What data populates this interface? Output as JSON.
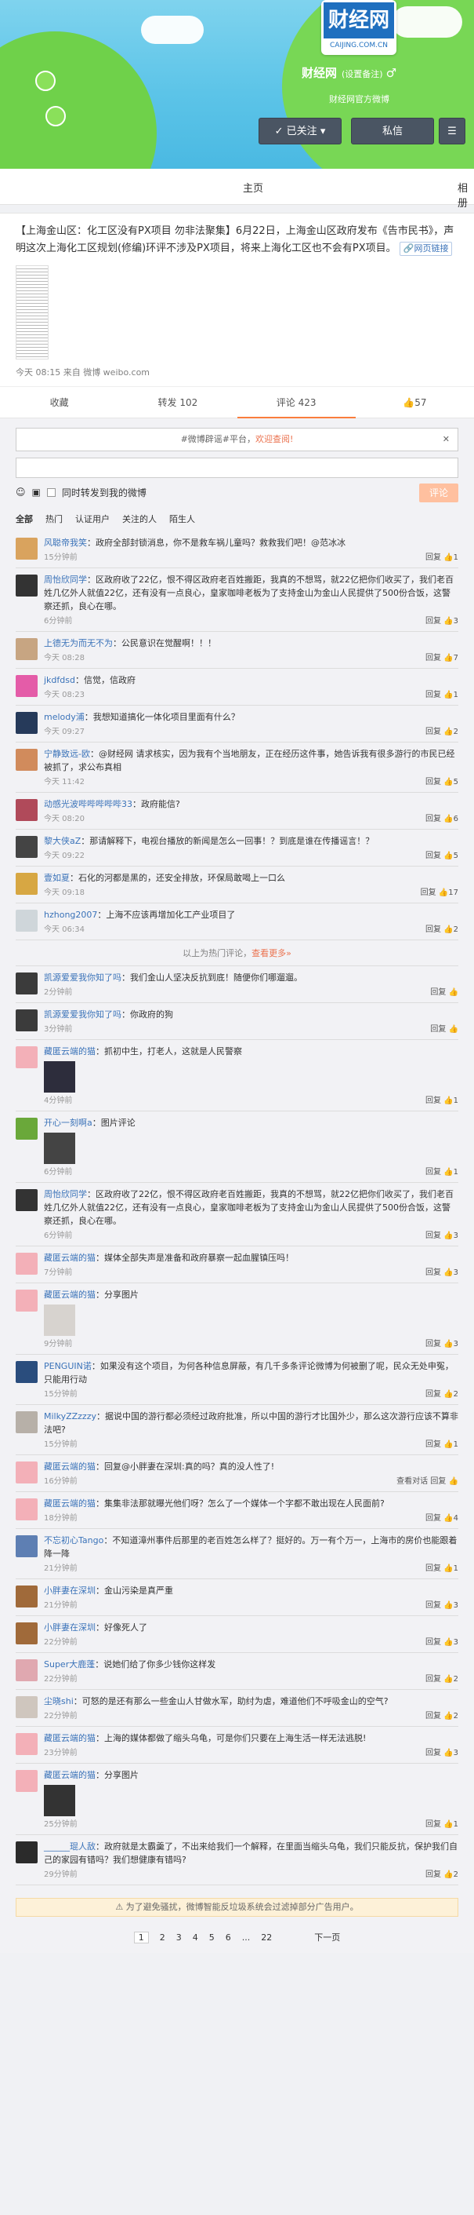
{
  "header": {
    "logo_text": "财经网",
    "logo_url": "CAIJING.COM.CN",
    "name": "财经网",
    "note": "(设置备注)",
    "gender": "♂",
    "desc": "财经网官方微博",
    "follow_btn": "✓ 已关注 ▾",
    "msg_btn": "私信",
    "menu": "☰",
    "colors": {
      "sky": "#5cc4e8",
      "grass": "#6fd14a"
    }
  },
  "tabs": {
    "home": "主页",
    "album": "相册"
  },
  "weibo": {
    "text": "【上海金山区：化工区没有PX项目 勿非法聚集】6月22日，上海金山区政府发布《告市民书》，声明这次上海化工区规划(修编)环评不涉及PX项目，将来上海化工区也不会有PX项目。",
    "link_label": "网页链接",
    "meta": "今天 08:15 来自 微博 weibo.com",
    "actions": {
      "fav": "收藏",
      "repost": "转发 102",
      "comment": "评论 423",
      "like": "57"
    }
  },
  "composer": {
    "topic": "#微博辟谣#平台，欢迎查阅!",
    "topic_pre": "#微博辟谣#平台，",
    "topic_link": "欢迎查阅!",
    "close": "✕",
    "sync_label": "同时转发到我的微博",
    "post_btn": "评论"
  },
  "filters": [
    "全部",
    "热门",
    "认证用户",
    "关注的人",
    "陌生人"
  ],
  "hot": [
    {
      "user": "风聪帝我笑",
      "text": "：政府全部封锁消息，你不是救车祸儿童吗？救救我们吧！@范冰冰",
      "time": "15分钟前",
      "reply": "回复",
      "like": "1",
      "c": "#d9a35e"
    },
    {
      "user": "周怡欣同学",
      "text": "：区政府收了22亿，恨不得区政府老百姓搬距，我真的不想骂，就22亿把你们收买了，我们老百姓几亿外人就值22亿，还有没有一点良心，皇家咖啡老板为了支持金山为金山人民提供了500份合饭，这警察还抓，良心在哪。",
      "time": "6分钟前",
      "reply": "回复",
      "like": "3",
      "c": "#333"
    },
    {
      "user": "上德无为而无不为",
      "text": "：公民意识在觉醒啊！！！",
      "time": "今天 08:28",
      "reply": "回复",
      "like": "7",
      "c": "#c7a582"
    },
    {
      "user": "jkdfdsd",
      "text": "：信觉，信政府",
      "time": "今天 08:23",
      "reply": "回复",
      "like": "1",
      "c": "#e45ca8"
    },
    {
      "user": "melody浦",
      "text": "：我想知道搞化一体化项目里面有什么？",
      "time": "今天 09:27",
      "reply": "回复",
      "like": "2",
      "c": "#263a5a"
    },
    {
      "user": "宁静致远-欧",
      "text": "：@财经网 请求核实，因为我有个当地朋友，正在经历这件事，她告诉我有很多游行的市民已经被抓了，求公布真相",
      "time": "今天 11:42",
      "reply": "回复",
      "like": "5",
      "c": "#d18b5c"
    },
    {
      "user": "动感光波哔哔哔哔哔33",
      "text": "：政府能信?",
      "time": "今天 08:20",
      "reply": "回复",
      "like": "6",
      "c": "#b04a5a"
    },
    {
      "user": "黎大侠aZ",
      "text": "：那请解释下，电视台播放的新闻是怎么一回事！？到底是谁在传播谣言！？",
      "time": "今天 09:22",
      "reply": "回复",
      "like": "5",
      "c": "#444"
    },
    {
      "user": "壹如夏",
      "text": "：石化的河都是黑的，还安全排放，环保局敢喝上一口么",
      "time": "今天 09:18",
      "reply": "回复",
      "like": "17",
      "c": "#d7a743"
    },
    {
      "user": "hzhong2007",
      "text": "：上海不应该再增加化工产业项目了",
      "time": "今天 06:34",
      "reply": "回复",
      "like": "2",
      "c": "#cfd6da"
    }
  ],
  "sep_text": "以上为热门评论，",
  "sep_link": "查看更多»",
  "latest": [
    {
      "user": "凯源爱爱我你知了吗",
      "text": "：我们金山人坚决反抗到底！随便你们哪遛遛。",
      "time": "2分钟前",
      "reply": "回复",
      "like": "",
      "c": "#3b3b3b"
    },
    {
      "user": "凯源爱爱我你知了吗",
      "text": "：你政府的狗",
      "time": "3分钟前",
      "reply": "回复",
      "like": "",
      "c": "#3b3b3b"
    },
    {
      "user": "藏匿云端的猫",
      "text": "：抓初中生，打老人，这就是人民警察",
      "time": "4分钟前",
      "reply": "回复",
      "like": "1",
      "c": "#f3b0b8",
      "img": "#2d2d3c",
      "imgh": 40
    },
    {
      "user": "开心一刻啊a",
      "text": "：图片评论",
      "time": "6分钟前",
      "reply": "回复",
      "like": "1",
      "c": "#6aa83a",
      "img": "#444",
      "imgh": 50
    },
    {
      "user": "周怡欣同学",
      "text": "：区政府收了22亿，恨不得区政府老百姓搬距，我真的不想骂，就22亿把你们收买了，我们老百姓几亿外人就值22亿，还有没有一点良心，皇家咖啡老板为了支持金山为金山人民提供了500份合饭，这警察还抓，良心在哪。",
      "time": "6分钟前",
      "reply": "回复",
      "like": "3",
      "c": "#333"
    },
    {
      "user": "藏匿云端的猫",
      "text": "：媒体全部失声是准备和政府暴察一起血腥镇压吗！",
      "time": "7分钟前",
      "reply": "回复",
      "like": "3",
      "c": "#f3b0b8"
    },
    {
      "user": "藏匿云端的猫",
      "text": "：分享图片",
      "time": "9分钟前",
      "reply": "回复",
      "like": "3",
      "c": "#f3b0b8",
      "img": "#d7d3cf",
      "imgh": 60
    },
    {
      "user": "PENGUIN诺",
      "text": "：如果没有这个项目，为何各种信息屏蔽，有几千多条评论微博为何被删了呢，民众无处申冤，只能用行动",
      "time": "15分钟前",
      "reply": "回复",
      "like": "2",
      "c": "#2a4d7d"
    },
    {
      "user": "MilkyZZzzzy",
      "text": "：据说中国的游行都必须经过政府批准，所以中国的游行才比国外少，那么这次游行应该不算非法吧?",
      "time": "15分钟前",
      "reply": "回复",
      "like": "1",
      "c": "#b7b0a8"
    },
    {
      "user": "藏匿云端的猫",
      "text": "：回复@小胖妻在深圳:真的吗？真的没人性了!",
      "time": "16分钟前",
      "reply": "查看对话  回复",
      "like": "",
      "c": "#f3b0b8"
    },
    {
      "user": "藏匿云端的猫",
      "text": "：集集非法那就曝光他们呀？怎么了一个媒体一个字都不敢出现在人民面前?",
      "time": "18分钟前",
      "reply": "回复",
      "like": "4",
      "c": "#f3b0b8"
    },
    {
      "user": "不忘初心Tango",
      "text": "：不知道漳州事件后那里的老百姓怎么样了？挺好的。万一有个万一，上海市的房价也能跟着降一降",
      "time": "21分钟前",
      "reply": "回复",
      "like": "1",
      "c": "#5e7fb3"
    },
    {
      "user": "小胖妻在深圳",
      "text": "：金山污染是真严重",
      "time": "21分钟前",
      "reply": "回复",
      "like": "3",
      "c": "#a06a3a"
    },
    {
      "user": "小胖妻在深圳",
      "text": "：好像死人了",
      "time": "22分钟前",
      "reply": "回复",
      "like": "3",
      "c": "#a06a3a"
    },
    {
      "user": "Super大鹿蓬",
      "text": "：说她们给了你多少钱你这样发",
      "time": "22分钟前",
      "reply": "回复",
      "like": "2",
      "c": "#e0a8b0"
    },
    {
      "user": "尘晓shi",
      "text": "：可怒的是还有那么一些金山人甘做水军，助纣为虐，难道他们不呼吸金山的空气?",
      "time": "22分钟前",
      "reply": "回复",
      "like": "2",
      "c": "#cfc6be"
    },
    {
      "user": "藏匿云端的猫",
      "text": "：上海的媒体都做了缩头乌龟，可是你们只要在上海生活一样无法逃脱!",
      "time": "23分钟前",
      "reply": "回复",
      "like": "3",
      "c": "#f3b0b8"
    },
    {
      "user": "藏匿云端的猫",
      "text": "：分享图片",
      "time": "25分钟前",
      "reply": "回复",
      "like": "1",
      "c": "#f3b0b8",
      "img": "#333",
      "imgh": 56
    },
    {
      "user": "______琨人敌",
      "text": "：政府就是太霸羹了，不出来给我们一个解释，在里面当缩头乌龟，我们只能反抗，保护我们自己的家园有错吗？我们想健康有错吗?",
      "time": "29分钟前",
      "reply": "回复",
      "like": "2",
      "c": "#2b2b2b"
    }
  ],
  "warn": "为了避免骚扰，微博智能反垃圾系统会过滤掉部分广告用户。",
  "pager": {
    "pages": [
      "1",
      "2",
      "3",
      "4",
      "5",
      "6",
      "...",
      "22"
    ],
    "next": "下一页"
  }
}
